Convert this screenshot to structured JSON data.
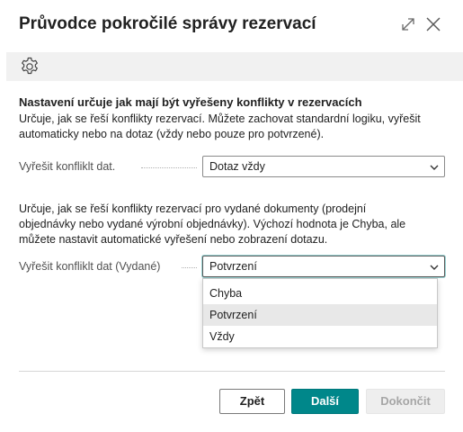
{
  "window": {
    "title": "Průvodce pokročilé správy rezervací",
    "expand_icon": "expand-icon",
    "close_icon": "close-icon"
  },
  "toolbar": {
    "settings_icon": "gear-icon"
  },
  "section1": {
    "heading": "Nastavení určuje jak mají být vyřešeny konflikty v rezervacích",
    "description_lines": [
      "Určuje, jak se řeší konflikty rezervací. Můžete zachovat standardní logiku, vyřešit",
      "automaticky nebo na dotaz (vždy nebo pouze pro potvrzené)."
    ],
    "field": {
      "label": "Vyřešit konfliklt dat.",
      "value": "Dotaz vždy"
    }
  },
  "section2": {
    "description_lines": [
      "Určuje, jak se řeší konflikty rezervací pro vydané dokumenty (prodejní",
      "objednávky nebo vydané výrobní objednávky). Výchozí hodnota je Chyba, ale",
      "můžete nastavit automatické vyřešení nebo zobrazení dotazu."
    ],
    "field": {
      "label": "Vyřešit konfliklt dat (Vydané)",
      "value": "Potvrzení",
      "options": [
        "Chyba",
        "Potvrzení",
        "Vždy"
      ],
      "highlighted_option": "Potvrzení"
    }
  },
  "buttons": {
    "back": "Zpět",
    "next": "Další",
    "finish": "Dokončit"
  },
  "colors": {
    "primary": "#00878a",
    "toolbar_bg": "#f1f1f1",
    "disabled_text": "#a6a6a6",
    "option_highlight": "#e8e8e8"
  }
}
